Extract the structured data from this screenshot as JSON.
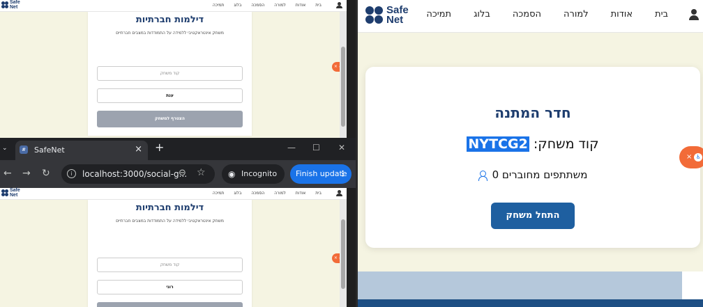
{
  "site": {
    "logo_line1": "Safe",
    "logo_line2": "Net",
    "nav": [
      "בית",
      "אודות",
      "למורה",
      "הסמכה",
      "בלוג",
      "תמיכה"
    ]
  },
  "top_pane": {
    "title": "דילמות חברתיות",
    "subtitle": "משחק אינטראקטיבי ללמידה על התמודדות במצבים חברתיים",
    "code_placeholder": "קוד משחק",
    "name_value": "ענת",
    "join_label": "הצטרף למשחק",
    "bubble": "× ♿"
  },
  "browser": {
    "tab_title": "SafeNet",
    "url": "localhost:3000/social-g...",
    "incognito_label": "Incognito (2)",
    "finish_label": "Finish update"
  },
  "bottom_pane": {
    "title": "דילמות חברתיות",
    "subtitle": "משחק אינטראקטיבי ללמידה על התמודדות במצבים חברתיים",
    "code_placeholder": "קוד משחק",
    "name_value": "רוני",
    "bubble": "× ♿"
  },
  "waiting_room": {
    "title": "חדר המתנה",
    "code_label": "קוד משחק:",
    "code_value": "NYTCG2",
    "participants_count": "0",
    "participants_label": "משתתפים מחוברים",
    "start_label": "התחל משחק",
    "bubble_close": "×",
    "bubble_icon": "♿"
  },
  "colors": {
    "brand": "#1e3d6e",
    "page_bg": "#f5f4e2",
    "primary_button": "#1e5fa0",
    "accent_orange": "#f26b38",
    "chrome_blue": "#1a73e8"
  }
}
